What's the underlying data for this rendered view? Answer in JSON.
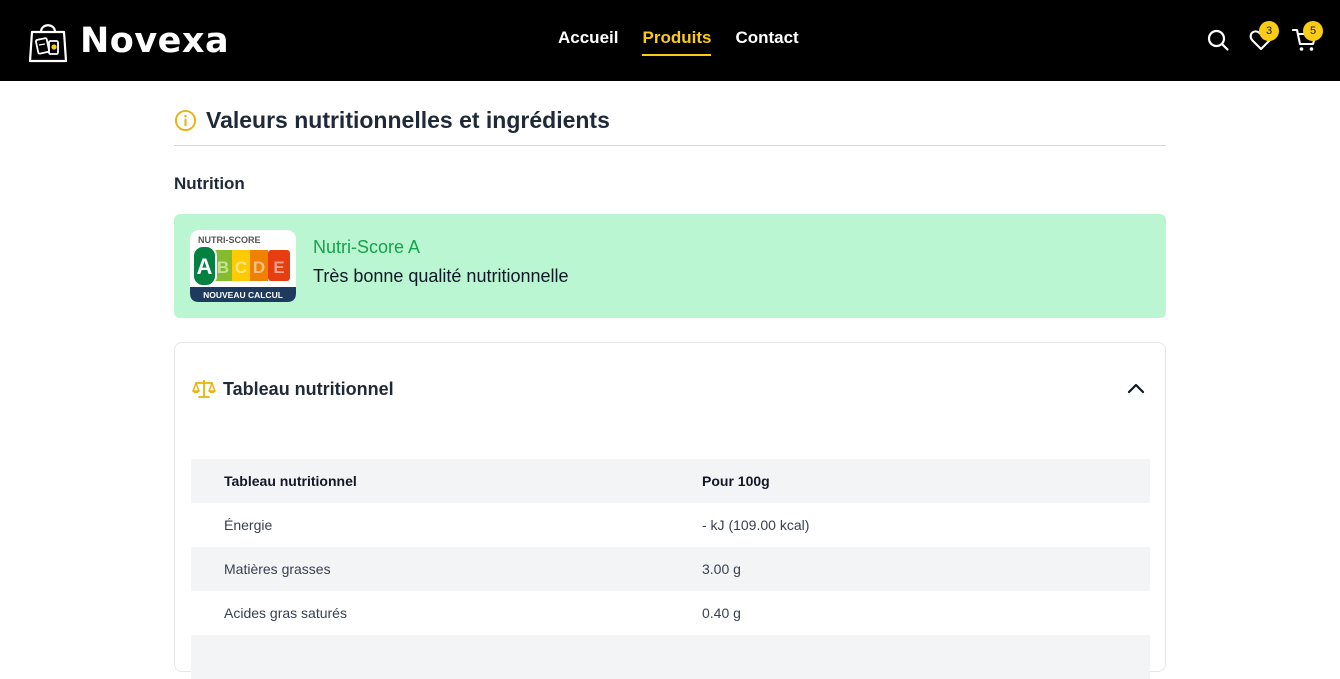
{
  "brand": {
    "name": "Novexa",
    "icon": "shopping-bag-logo-icon"
  },
  "nav": {
    "links": [
      {
        "label": "Accueil",
        "active": false
      },
      {
        "label": "Produits",
        "active": true
      },
      {
        "label": "Contact",
        "active": false
      }
    ],
    "icons": {
      "search": "search-icon",
      "wishlist": "heart-icon",
      "cart": "cart-icon"
    },
    "wishlist_count": "3",
    "cart_count": "5"
  },
  "section": {
    "title": "Valeurs nutritionnelles et ingrédients",
    "icon": "info-icon",
    "subtitle": "Nutrition"
  },
  "nutriscore": {
    "logo_top": "NUTRI-SCORE",
    "logo_bottom": "NOUVEAU CALCUL",
    "letters": [
      "A",
      "B",
      "C",
      "D",
      "E"
    ],
    "selected": "A",
    "grade_label": "Nutri-Score A",
    "description": "Très bonne qualité nutritionnelle"
  },
  "nutrition_table": {
    "card_title": "Tableau nutritionnel",
    "icon": "scale-icon",
    "expanded": true,
    "headers": [
      "Tableau nutritionnel",
      "Pour 100g"
    ],
    "rows": [
      {
        "name": "Énergie",
        "value": "- kJ (109.00 kcal)"
      },
      {
        "name": "Matières grasses",
        "value": "3.00 g"
      },
      {
        "name": "Acides gras saturés",
        "value": "0.40 g"
      }
    ]
  },
  "colors": {
    "accent": "#facc15",
    "navbar_bg": "#000000",
    "nutri_bg": "#b9f6d1",
    "nutri_text": "#16a34a",
    "nutri_a": "#038141",
    "nutri_b": "#85bb2f",
    "nutri_c": "#fecb02",
    "nutri_d": "#ee8100",
    "nutri_e": "#e63e11"
  }
}
